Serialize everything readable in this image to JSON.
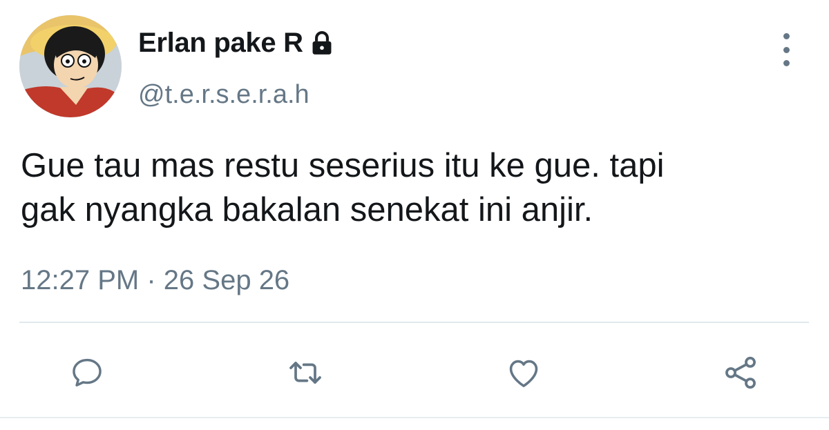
{
  "tweet": {
    "author": {
      "display_name": "Erlan pake R",
      "handle": "@t.e.r.s.e.r.a.h",
      "avatar": "avatar-image",
      "badge_icon": "lock-icon"
    },
    "text_lines": [
      "Gue tau mas restu seserius itu ke gue. tapi",
      "gak nyangka bakalan senekat ini anjir."
    ],
    "time": "12:27 PM",
    "separator": "·",
    "date": "26 Sep 26"
  },
  "actions": {
    "reply_icon": "reply-icon",
    "retweet_icon": "retweet-icon",
    "like_icon": "heart-icon",
    "share_icon": "share-icon",
    "more_icon": "more-vertical-icon"
  },
  "colors": {
    "text": "#14171a",
    "secondary": "#657786",
    "divider": "#e1e8ed"
  }
}
